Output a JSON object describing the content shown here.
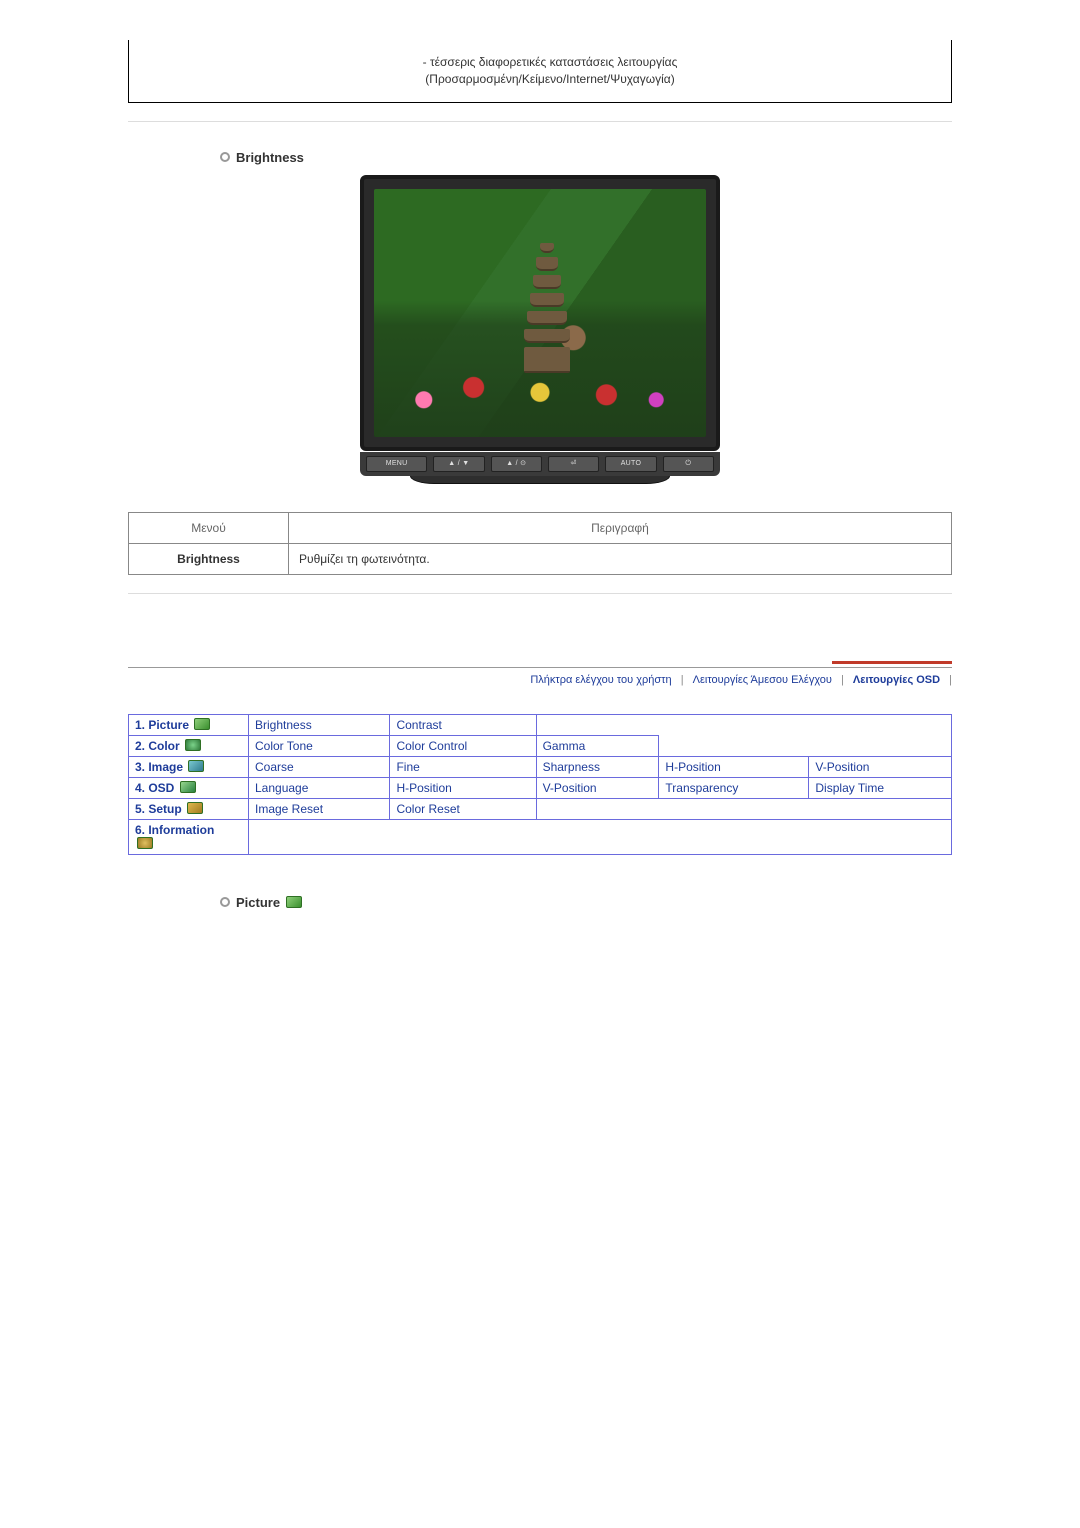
{
  "top_box": {
    "line1": "- τέσσερις διαφορετικές καταστάσεις λειτουργίας",
    "line2": "(Προσαρμοσμένη/Κείμενο/Internet/Ψυχαγωγία)"
  },
  "brightness_section": {
    "title": "Brightness",
    "monitor_buttons": [
      "MENU",
      "▲ / ▼",
      "▲ / ⊙",
      "⏎",
      "AUTO",
      "⏻"
    ]
  },
  "desc_table": {
    "headers": {
      "menu": "Μενού",
      "desc": "Περιγραφή"
    },
    "menu_name": "Brightness",
    "description": "Ρυθμίζει τη φωτεινότητα."
  },
  "tabs": {
    "t1": "Πλήκτρα ελέγχου του χρήστη",
    "t2": "Λειτουργίες Άμεσου Ελέγχου",
    "t3": "Λειτουργίες OSD"
  },
  "menu_table": [
    {
      "label": "1. Picture",
      "icon": "picture",
      "items": [
        "Brightness",
        "Contrast"
      ]
    },
    {
      "label": "2. Color",
      "icon": "color",
      "items": [
        "Color Tone",
        "Color Control",
        "Gamma"
      ]
    },
    {
      "label": "3. Image",
      "icon": "image",
      "items": [
        "Coarse",
        "Fine",
        "Sharpness",
        "H-Position",
        "V-Position"
      ]
    },
    {
      "label": "4. OSD",
      "icon": "osd",
      "items": [
        "Language",
        "H-Position",
        "V-Position",
        "Transparency",
        "Display Time"
      ]
    },
    {
      "label": "5. Setup",
      "icon": "setup",
      "items": [
        "Image Reset",
        "Color Reset"
      ]
    },
    {
      "label": "6. Information",
      "icon": "info",
      "items": []
    }
  ],
  "picture_section": {
    "title": "Picture"
  }
}
